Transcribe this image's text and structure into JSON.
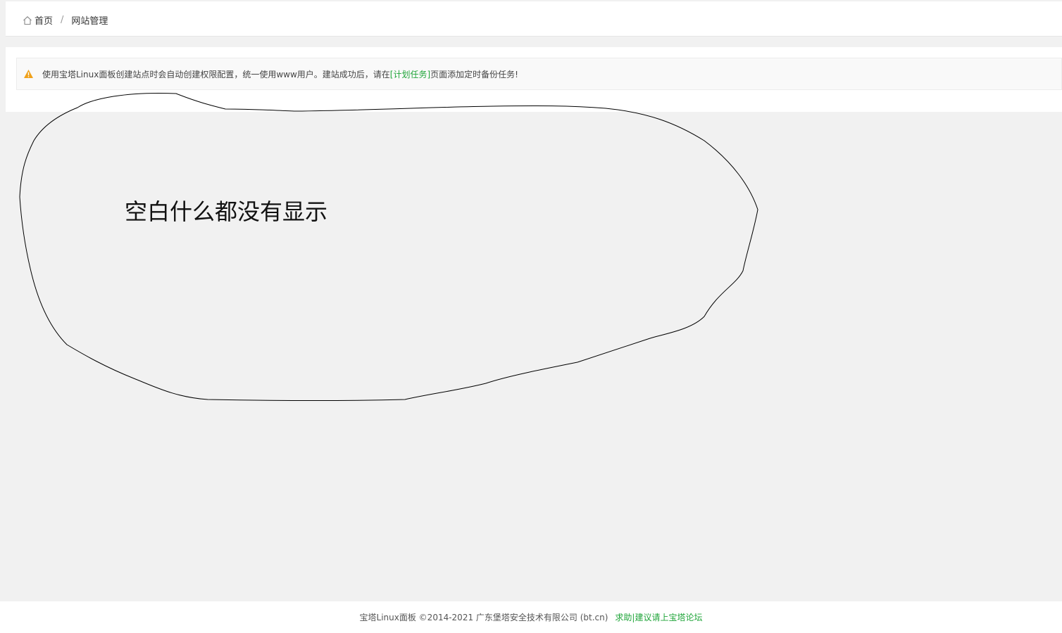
{
  "breadcrumb": {
    "home_label": "首页",
    "separator": "/",
    "current": "网站管理"
  },
  "notice": {
    "text_before": "使用宝塔Linux面板创建站点时会自动创建权限配置，统一使用www用户。建站成功后，请在",
    "link_text": "[计划任务]",
    "text_after": "页面添加定时备份任务!",
    "icon": "warning-triangle-icon",
    "icon_color": "#f0a11a"
  },
  "annotation": {
    "text": "空白什么都没有显示"
  },
  "footer": {
    "copyright": "宝塔Linux面板 ©2014-2021 广东堡塔安全技术有限公司 (bt.cn)",
    "link_text": "求助|建议请上宝塔论坛"
  },
  "colors": {
    "accent": "#20a53a",
    "background": "#f1f1f1"
  }
}
